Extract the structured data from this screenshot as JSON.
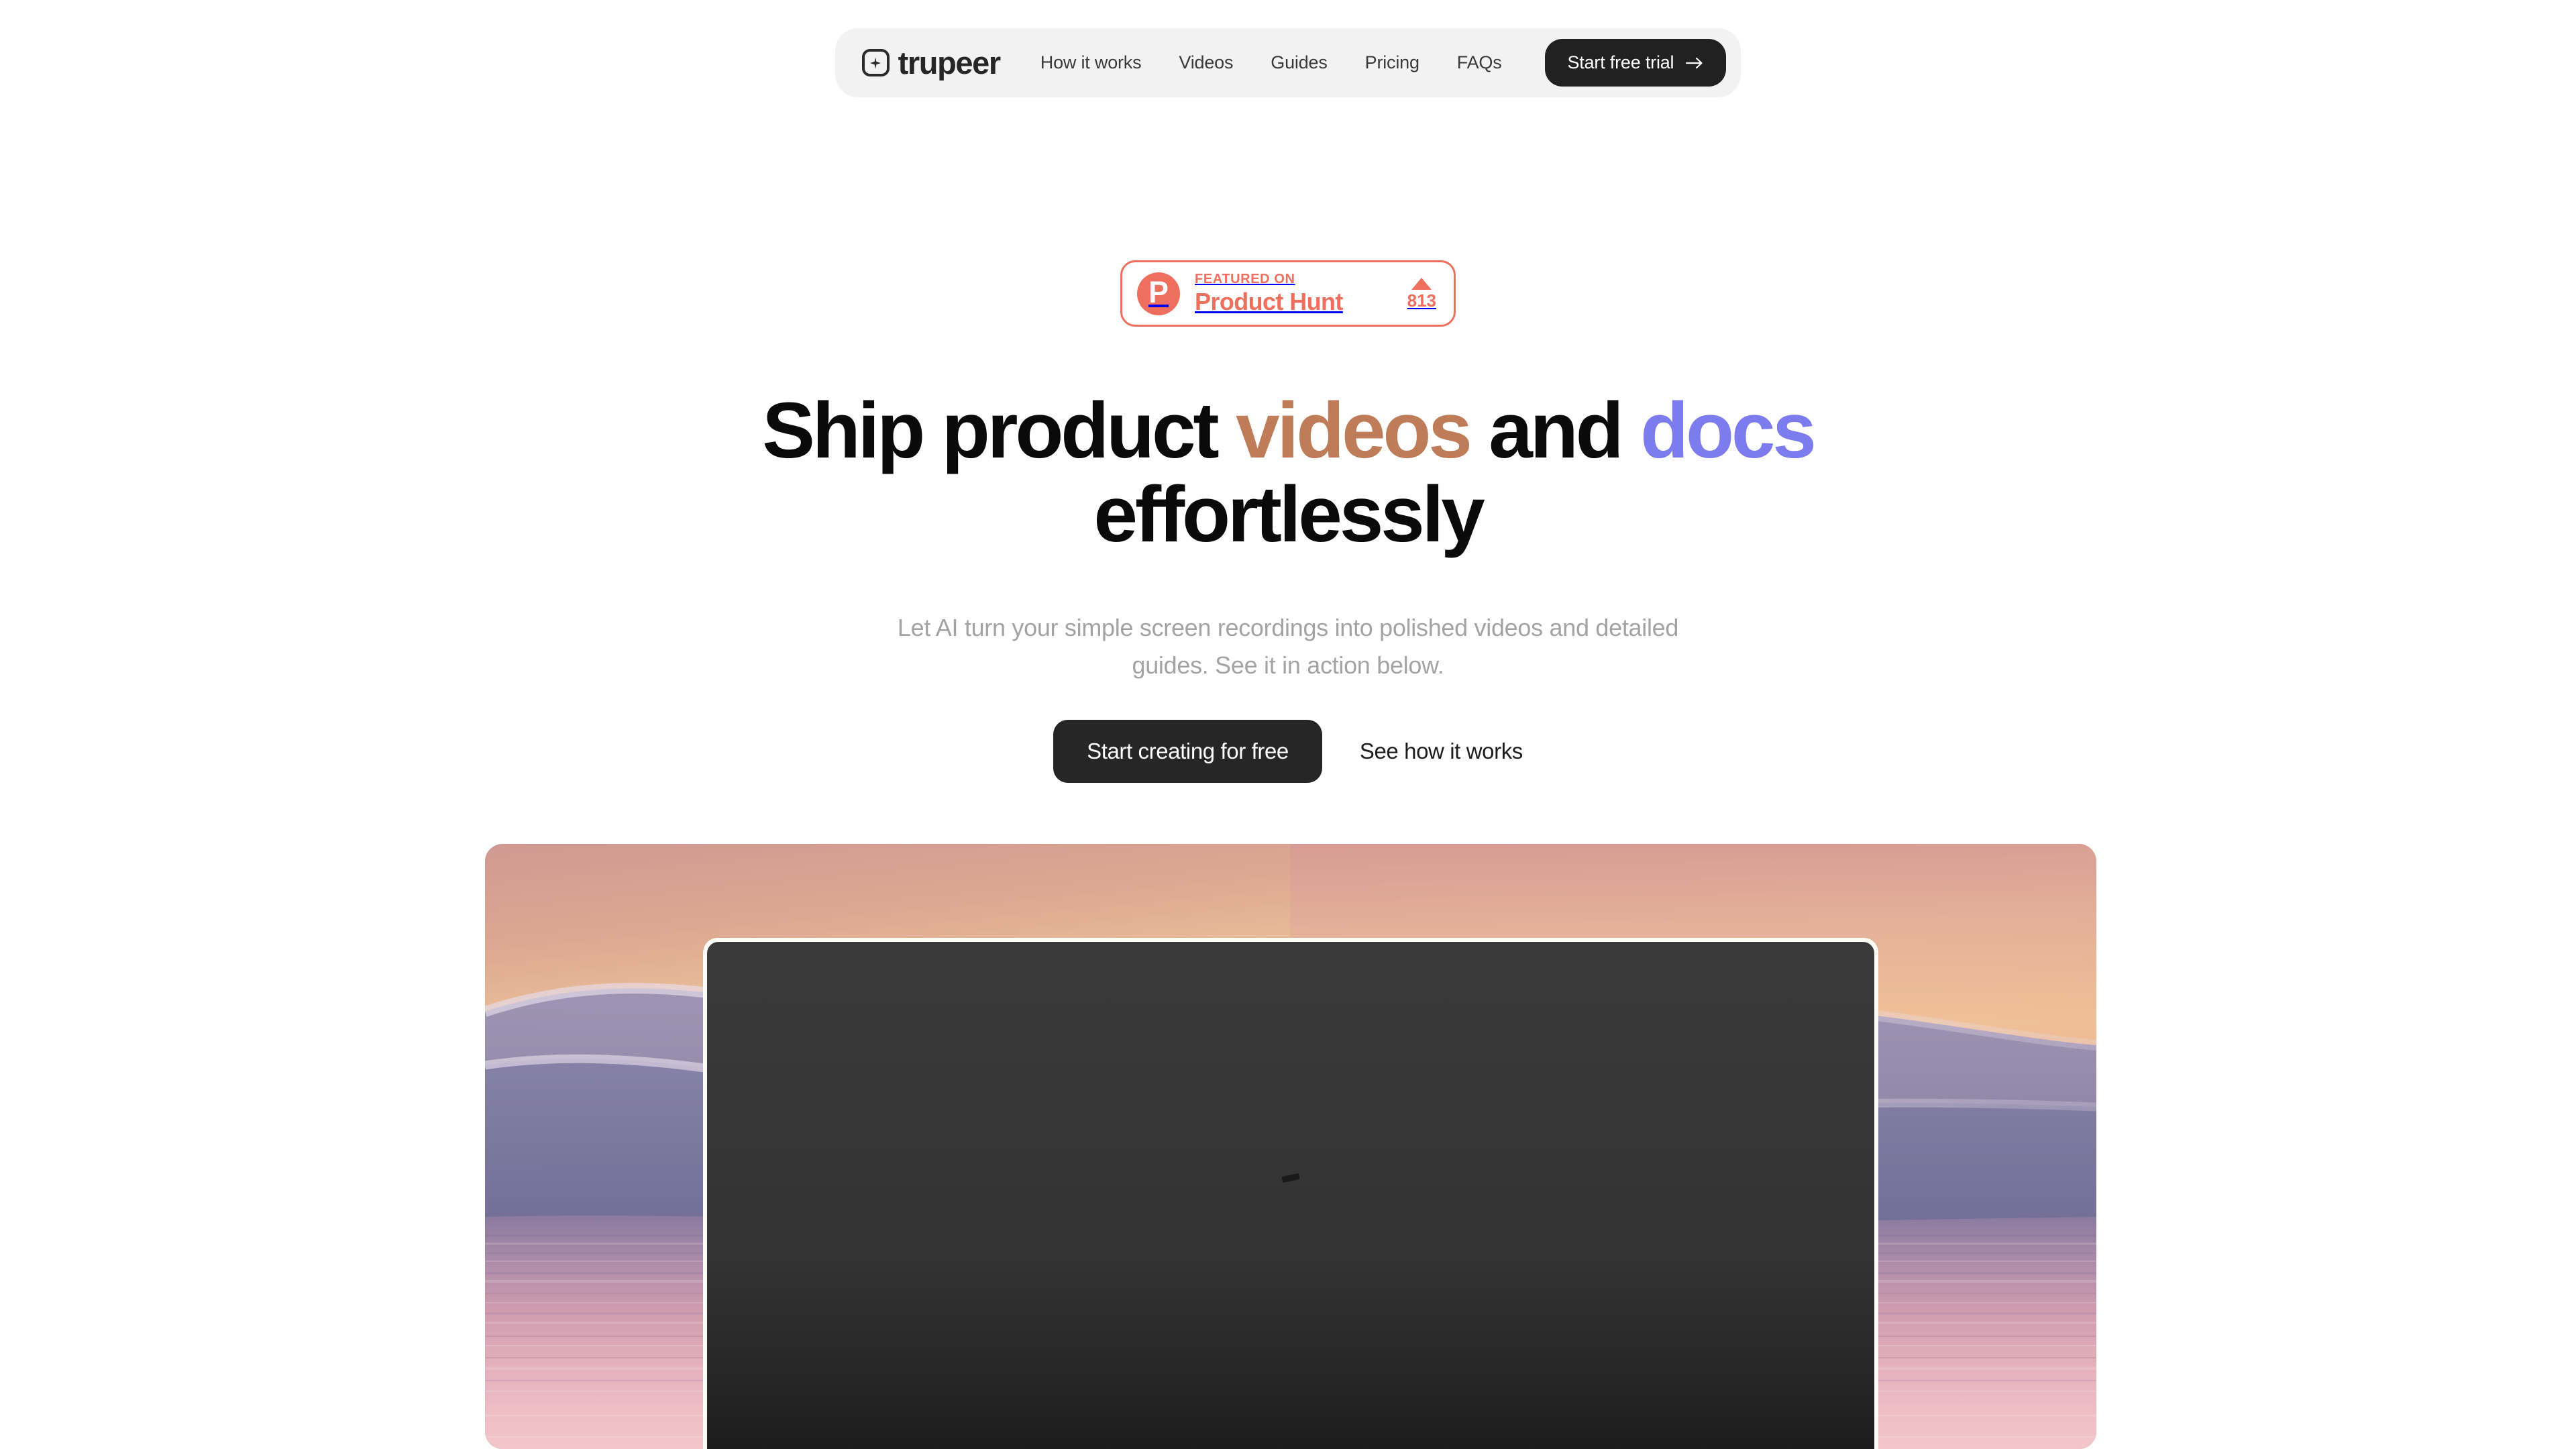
{
  "nav": {
    "brand_name": "trupeer",
    "brand_icon": "sparkle-in-rounded-square-icon",
    "links": [
      {
        "label": "How it works"
      },
      {
        "label": "Videos"
      },
      {
        "label": "Guides"
      },
      {
        "label": "Pricing"
      },
      {
        "label": "FAQs"
      }
    ],
    "cta_label": "Start free trial",
    "cta_icon": "arrow-right-icon"
  },
  "badge": {
    "logo_letter": "P",
    "eyebrow": "FEATURED ON",
    "title": "Product Hunt",
    "upvote_icon": "triangle-up-icon",
    "votes": "813",
    "accent_color": "#EE6F5E"
  },
  "hero": {
    "headline_part1": "Ship product ",
    "headline_highlight1": "videos",
    "headline_part2": " and ",
    "headline_highlight2": "docs",
    "headline_part3": " effortlessly",
    "highlight1_color": "#BE7D58",
    "highlight2_color": "#7C7CEE",
    "subhead": "Let AI turn your simple screen recordings into polished videos and detailed guides. See it in action below.",
    "cta_primary": "Start creating for free",
    "cta_secondary": "See how it works"
  },
  "media": {
    "background_description": "sunset landscape with orange-peach sky, purple mountains and pink reflective water",
    "player_state": "dark video player frame"
  }
}
